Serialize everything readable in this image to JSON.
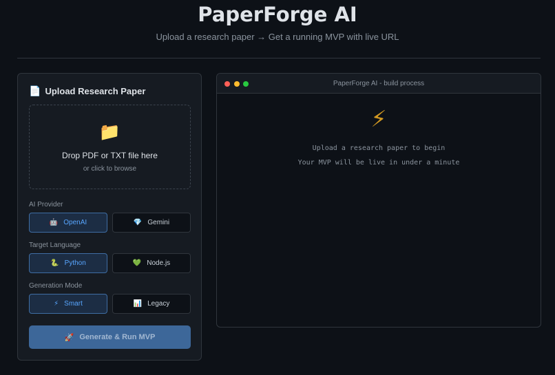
{
  "header": {
    "title": "PaperForge AI",
    "subtitle": "Upload a research paper → Get a running MVP with live URL"
  },
  "upload_panel": {
    "title": "Upload Research Paper",
    "title_icon": "document-icon",
    "dropzone": {
      "icon": "folder-icon",
      "primary_text": "Drop PDF or TXT file here",
      "secondary_text": "or click to browse"
    },
    "groups": [
      {
        "label": "AI Provider",
        "options": [
          {
            "icon": "robot-icon",
            "glyph": "🤖",
            "label": "OpenAI",
            "active": true
          },
          {
            "icon": "gem-icon",
            "glyph": "💎",
            "label": "Gemini",
            "active": false
          }
        ]
      },
      {
        "label": "Target Language",
        "options": [
          {
            "icon": "snake-icon",
            "glyph": "🐍",
            "label": "Python",
            "active": true
          },
          {
            "icon": "green-heart-icon",
            "glyph": "💚",
            "label": "Node.js",
            "active": false
          }
        ]
      },
      {
        "label": "Generation Mode",
        "options": [
          {
            "icon": "lightning-icon",
            "glyph": "⚡",
            "label": "Smart",
            "active": true
          },
          {
            "icon": "bar-chart-icon",
            "glyph": "📊",
            "label": "Legacy",
            "active": false
          }
        ]
      }
    ],
    "generate_button": {
      "icon": "rocket-icon",
      "glyph": "🚀",
      "label": "Generate & Run MVP"
    }
  },
  "terminal": {
    "title": "PaperForge AI - build process",
    "icon": "lightning-icon",
    "lines": [
      "Upload a research paper to begin",
      "Your MVP will be live in under a minute"
    ]
  },
  "colors": {
    "background": "#0d1117",
    "panel": "#161b22",
    "accent": "#58a6ff",
    "button": "#3d6799"
  }
}
